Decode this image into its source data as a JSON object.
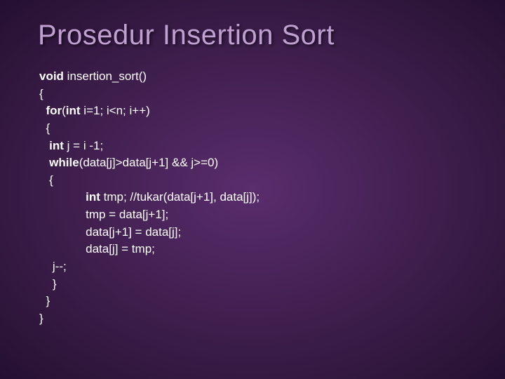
{
  "title": "Prosedur Insertion Sort",
  "code": {
    "l0a": "void",
    "l0b": " insertion_sort()",
    "l1": "{",
    "l2a": "  for",
    "l2b": "(",
    "l2c": "int",
    "l2d": " i=1; i<n; i++)",
    "l3": "  {",
    "l4a": "   int",
    "l4b": " j = i -1;",
    "l5a": "   while",
    "l5b": "(data[j]>data[j+1] && j>=0)",
    "l6": "   {",
    "l7a": "              int",
    "l7b": " tmp; //tukar(data[j+1], data[j]);",
    "l8": "              tmp = data[j+1];",
    "l9": "              data[j+1] = data[j];",
    "l10": "              data[j] = tmp;",
    "l11": "    j--;",
    "l12": "    }",
    "l13": "  }",
    "l14": "}"
  }
}
